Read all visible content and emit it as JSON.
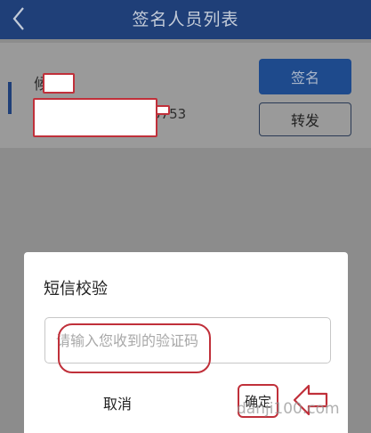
{
  "header": {
    "title": "签名人员列表",
    "back_icon": "chevron-left-icon"
  },
  "signer": {
    "name_visible": "候",
    "phone_visible": "5753"
  },
  "actions": {
    "sign_label": "签名",
    "forward_label": "转发"
  },
  "dialog": {
    "title": "短信校验",
    "input_value": "",
    "input_placeholder": "请输入您收到的验证码",
    "cancel_label": "取消",
    "confirm_label": "确定"
  },
  "watermark": {
    "text": "danji100.com"
  },
  "colors": {
    "header": "#1f3f78",
    "sign_button": "#1e4a8c",
    "annotation": "#c0303a"
  }
}
